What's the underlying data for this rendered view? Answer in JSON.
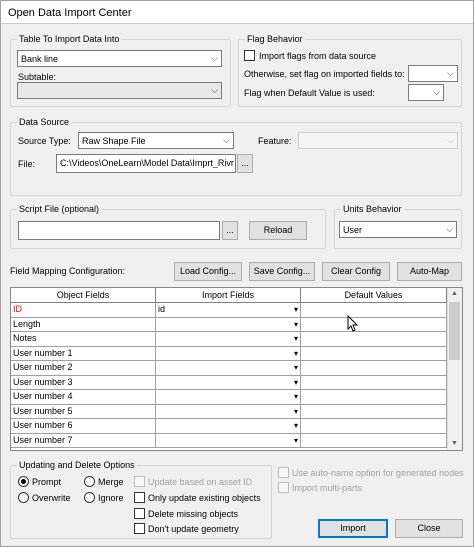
{
  "window": {
    "title": "Open Data Import Center"
  },
  "table_group": {
    "title": "Table To Import Data Into",
    "table_value": "Bank line",
    "subtable_label": "Subtable:",
    "subtable_value": ""
  },
  "flag_group": {
    "title": "Flag Behavior",
    "import_flags_label": "Import flags from data source",
    "otherwise_label": "Otherwise, set flag on imported fields to:",
    "default_value_label": "Flag when Default Value is used:"
  },
  "data_source": {
    "title": "Data Source",
    "source_type_label": "Source Type:",
    "source_type_value": "Raw Shape File",
    "feature_label": "Feature:",
    "file_label": "File:",
    "file_value": "C:\\Videos\\OneLearn\\Model Data\\Imprt_Rivr_",
    "browse_label": "..."
  },
  "script": {
    "title": "Script File (optional)",
    "value": "",
    "browse_label": "...",
    "reload_label": "Reload"
  },
  "units": {
    "title": "Units Behavior",
    "value": "User"
  },
  "mapping": {
    "label": "Field Mapping Configuration:",
    "load_label": "Load Config...",
    "save_label": "Save Config...",
    "clear_label": "Clear Config",
    "automap_label": "Auto-Map",
    "headers": [
      "Object Fields",
      "Import Fields",
      "Default Values"
    ],
    "rows": [
      {
        "object": "ID",
        "import": "id",
        "default": "",
        "required": true
      },
      {
        "object": "Length",
        "import": "",
        "default": "",
        "required": false
      },
      {
        "object": "Notes",
        "import": "",
        "default": "",
        "required": false
      },
      {
        "object": "User number 1",
        "import": "",
        "default": "",
        "required": false
      },
      {
        "object": "User number 2",
        "import": "",
        "default": "",
        "required": false
      },
      {
        "object": "User number 3",
        "import": "",
        "default": "",
        "required": false
      },
      {
        "object": "User number 4",
        "import": "",
        "default": "",
        "required": false
      },
      {
        "object": "User number 5",
        "import": "",
        "default": "",
        "required": false
      },
      {
        "object": "User number 6",
        "import": "",
        "default": "",
        "required": false
      },
      {
        "object": "User number 7",
        "import": "",
        "default": "",
        "required": false
      }
    ]
  },
  "update_group": {
    "title": "Updating and Delete Options",
    "prompt_label": "Prompt",
    "merge_label": "Merge",
    "overwrite_label": "Overwrite",
    "ignore_label": "Ignore",
    "update_asset_label": "Update based on asset ID",
    "only_update_label": "Only update existing objects",
    "delete_missing_label": "Delete missing objects",
    "dont_update_geom_label": "Don't update geometry",
    "selected_mode": "Prompt"
  },
  "options": {
    "auto_name_label": "Use auto-name option for generated nodes",
    "multi_parts_label": "Import multi-parts"
  },
  "footer": {
    "import_label": "Import",
    "close_label": "Close"
  },
  "icons": {
    "dropdown": "chevron-down-icon",
    "cell_dropdown": "cell-dropdown-icon",
    "cursor": "mouse-pointer-icon"
  }
}
